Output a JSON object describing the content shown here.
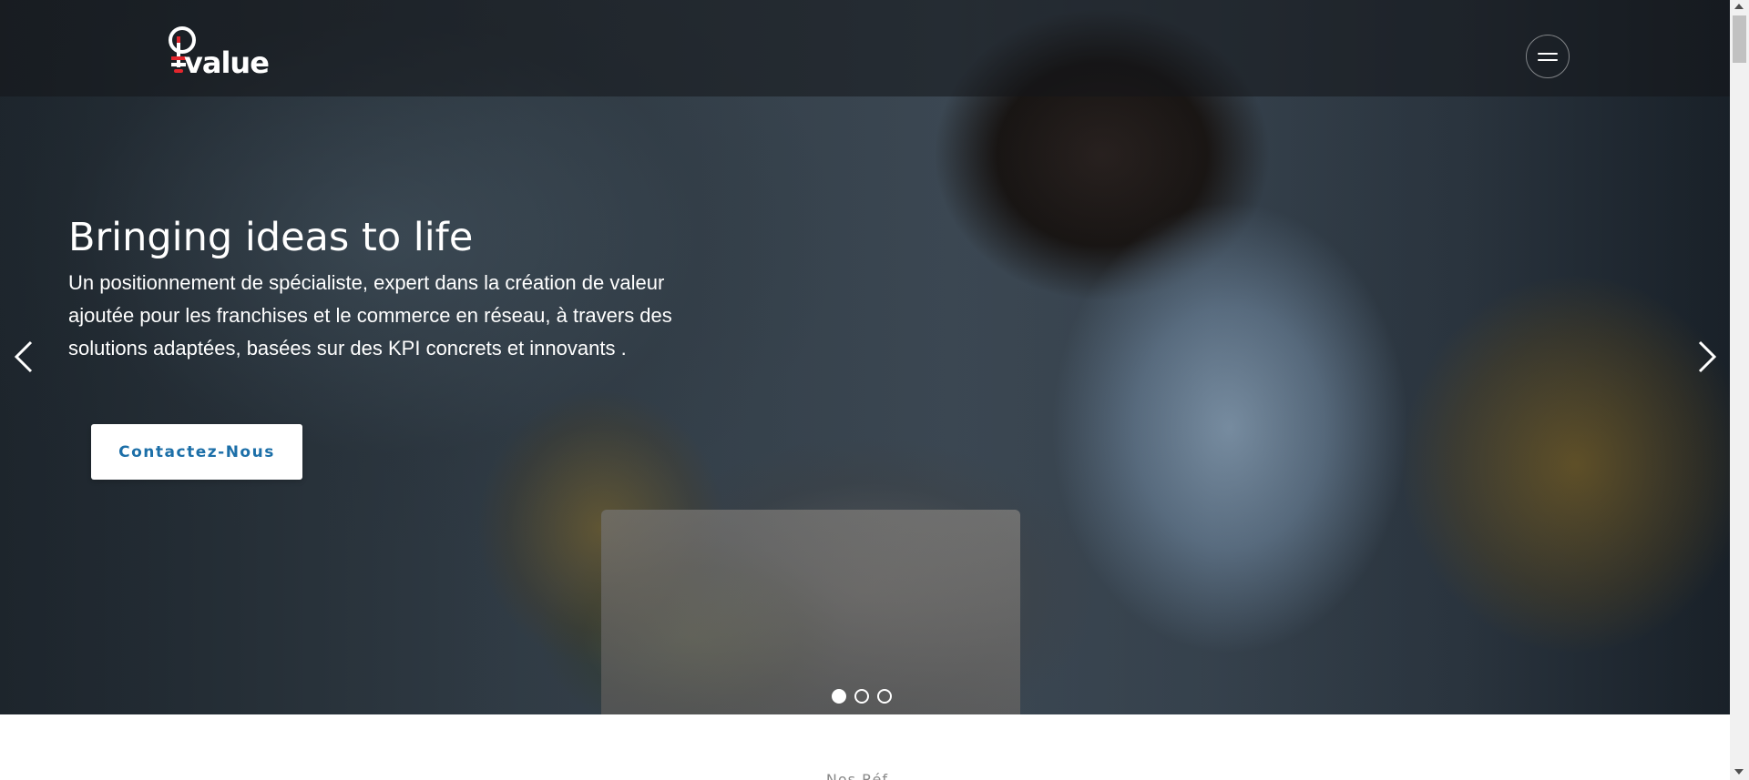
{
  "header": {
    "logo_text": "value",
    "logo_alt": "iValue",
    "menu_icon": "hamburger-icon"
  },
  "hero": {
    "title": "Bringing ideas to life",
    "text": "Un positionnement de spécialiste, expert dans la création de valeur ajoutée pour les franchises et le commerce en réseau, à travers des solutions adaptées, basées sur des KPI concrets et innovants .",
    "cta_label": "Contactez-Nous",
    "prev_icon": "chevron-left-icon",
    "next_icon": "chevron-right-icon",
    "slides": [
      {
        "active": true
      },
      {
        "active": false
      },
      {
        "active": false
      }
    ]
  },
  "next_section": {
    "heading_peek": "Nos Réf..."
  },
  "colors": {
    "accent": "#1c6fa8",
    "logo_red": "#e3262d",
    "header_overlay": "rgba(20,22,26,0.55)"
  }
}
